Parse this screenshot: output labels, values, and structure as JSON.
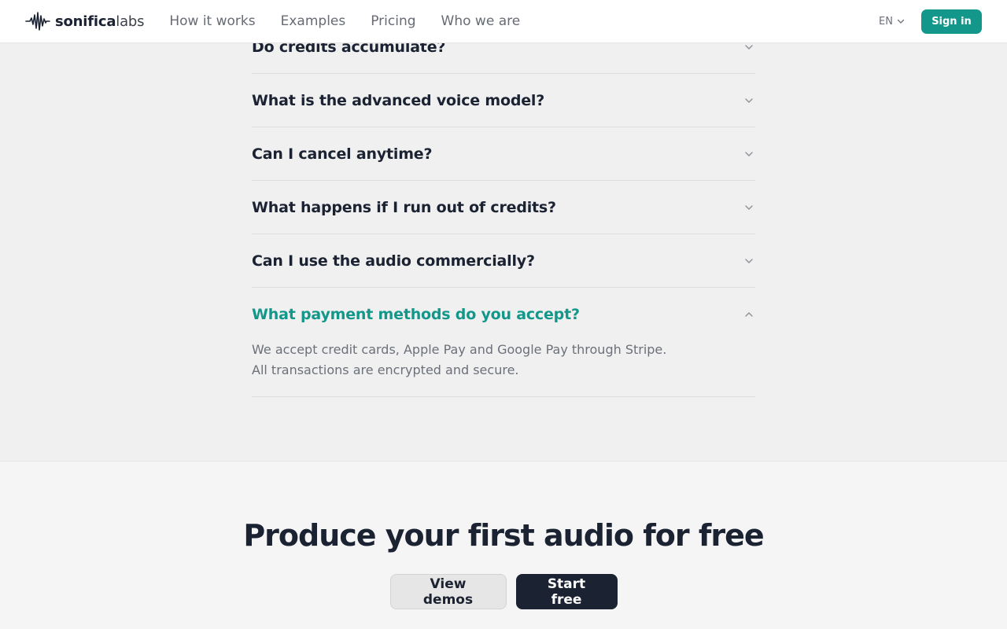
{
  "header": {
    "logo": {
      "bold": "sonifica",
      "light": "labs",
      "icon": "waveform-icon"
    },
    "nav": [
      {
        "label": "How it works"
      },
      {
        "label": "Examples"
      },
      {
        "label": "Pricing"
      },
      {
        "label": "Who we are"
      }
    ],
    "language": {
      "label": "EN",
      "icon": "chevron-down-icon"
    },
    "signin_label": "Sign in"
  },
  "faq": {
    "items": [
      {
        "question": "Do credits accumulate?",
        "open": false
      },
      {
        "question": "What is the advanced voice model?",
        "open": false
      },
      {
        "question": "Can I cancel anytime?",
        "open": false
      },
      {
        "question": "What happens if I run out of credits?",
        "open": false
      },
      {
        "question": "Can I use the audio commercially?",
        "open": false
      },
      {
        "question": "What payment methods do you accept?",
        "open": true,
        "answer": "We accept credit cards, Apple Pay and Google Pay through Stripe. All transactions are encrypted and secure."
      }
    ]
  },
  "cta": {
    "title": "Produce your first audio for free",
    "secondary_label": "View demos",
    "primary_label": "Start free"
  },
  "colors": {
    "accent": "#12978a",
    "dark": "#1b2232",
    "muted": "#6b7079"
  }
}
